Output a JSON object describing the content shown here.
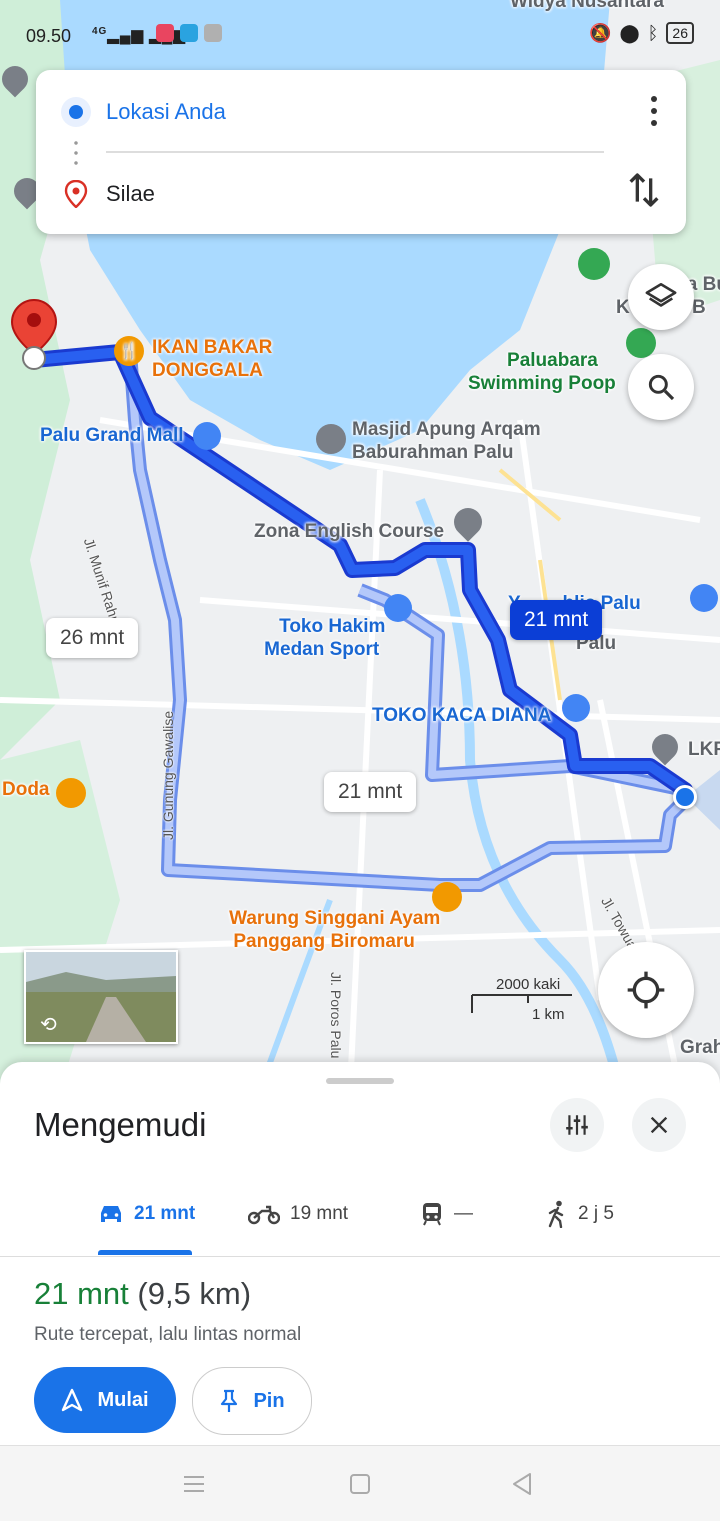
{
  "status_bar": {
    "time": "09.50",
    "signal": "4G",
    "battery": "26"
  },
  "directions": {
    "origin": "Lokasi Anda",
    "destination": "Silae"
  },
  "map": {
    "pois": [
      {
        "id": "ikan",
        "text": "IKAN BAKAR\nDONGGALA",
        "color": "orange"
      },
      {
        "id": "mall",
        "text": "Palu Grand Mall",
        "color": "blue"
      },
      {
        "id": "masjid",
        "text": "Masjid Apung Arqam\nBaburahman Palu",
        "color": "gray"
      },
      {
        "id": "zona",
        "text": "Zona English Course",
        "color": "gray"
      },
      {
        "id": "hakim",
        "text": "Toko Hakim\nMedan Sport",
        "color": "blue"
      },
      {
        "id": "republic",
        "text": "Y        blic Palu",
        "color": "blue"
      },
      {
        "id": "kaca",
        "text": "TOKO KACA DIANA",
        "color": "blue"
      },
      {
        "id": "lkp",
        "text": "LKP",
        "color": "gray"
      },
      {
        "id": "gelora",
        "text": "Gelora Bum\nK         GB",
        "color": "gray"
      },
      {
        "id": "paluabara",
        "text": "Paluabara\nSwimming Poop",
        "color": "green"
      },
      {
        "id": "doda",
        "text": "Doda",
        "color": "orange"
      },
      {
        "id": "warung",
        "text": "Warung Singgani Ayam\nPanggang Biromaru",
        "color": "orange"
      },
      {
        "id": "widya",
        "text": "Widya Nusantara",
        "color": "gray"
      },
      {
        "id": "grah",
        "text": "Grah",
        "color": "gray"
      },
      {
        "id": "palu",
        "text": "Palu",
        "color": "gray"
      }
    ],
    "roads": [
      "Jl. Munif Rahman",
      "Jl. Gunung Gawalise",
      "Jl. Poros Palu",
      "Jl. Towua"
    ],
    "route_labels": {
      "main": "21 mnt",
      "alt1": "26 mnt",
      "alt2": "21 mnt"
    },
    "scale": {
      "imperial": "2000 kaki",
      "metric": "1 km"
    }
  },
  "sheet": {
    "title": "Mengemudi",
    "modes": [
      {
        "icon": "car-icon",
        "label": "21 mnt",
        "active": true
      },
      {
        "icon": "motorcycle-icon",
        "label": "19 mnt",
        "active": false
      },
      {
        "icon": "transit-icon",
        "label": "—",
        "active": false
      },
      {
        "icon": "walk-icon",
        "label": "2 j 5",
        "active": false
      }
    ],
    "duration": "21 mnt",
    "distance": "(9,5 km)",
    "subtitle": "Rute tercepat, lalu lintas normal",
    "start_label": "Mulai",
    "pin_label": "Pin"
  },
  "colors": {
    "accent": "#1a73e8",
    "route": "#0b3ed6",
    "water": "#aadaff",
    "green": "#188038"
  }
}
